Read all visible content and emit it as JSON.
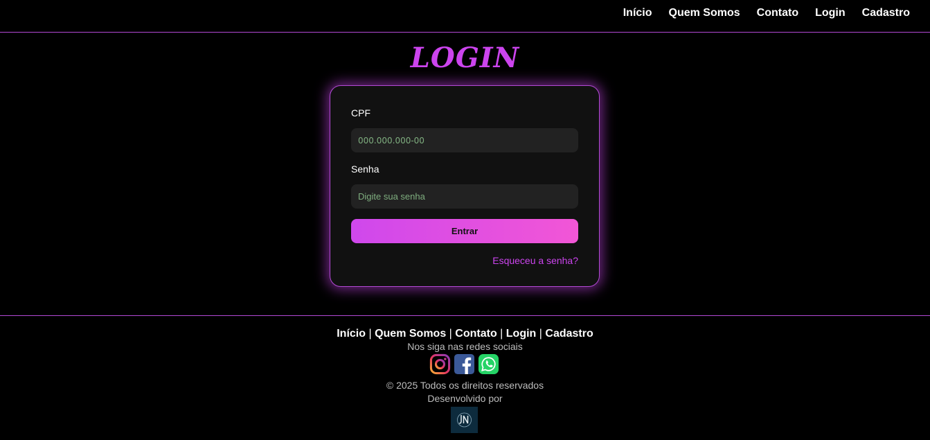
{
  "nav": {
    "items": [
      {
        "label": "Início"
      },
      {
        "label": "Quem Somos"
      },
      {
        "label": "Contato"
      },
      {
        "label": "Login"
      },
      {
        "label": "Cadastro"
      }
    ]
  },
  "title": "LOGIN",
  "form": {
    "cpf": {
      "label": "CPF",
      "placeholder": "000.000.000-00",
      "value": ""
    },
    "senha": {
      "label": "Senha",
      "placeholder": "Digite sua senha",
      "value": ""
    },
    "submit_label": "Entrar",
    "forgot_label": "Esqueceu a senha?"
  },
  "footer": {
    "links": [
      {
        "label": "Início"
      },
      {
        "label": "Quem Somos"
      },
      {
        "label": "Contato"
      },
      {
        "label": "Login"
      },
      {
        "label": "Cadastro"
      }
    ],
    "separator": "|",
    "follow_text": "Nos siga nas redes sociais",
    "social": [
      {
        "icon": "instagram-icon"
      },
      {
        "icon": "facebook-icon"
      },
      {
        "icon": "whatsapp-icon"
      }
    ],
    "copyright": "© 2025 Todos os direitos reservados",
    "developed_by": "Desenvolvido por",
    "dev_logo_text": "JN"
  },
  "colors": {
    "accent": "#cc44ee",
    "button_gradient_start": "#cf48ec",
    "button_gradient_end": "#f256d6",
    "background": "#000000",
    "card_background": "#111111",
    "input_background": "#222222",
    "placeholder": "#7fae7f"
  }
}
